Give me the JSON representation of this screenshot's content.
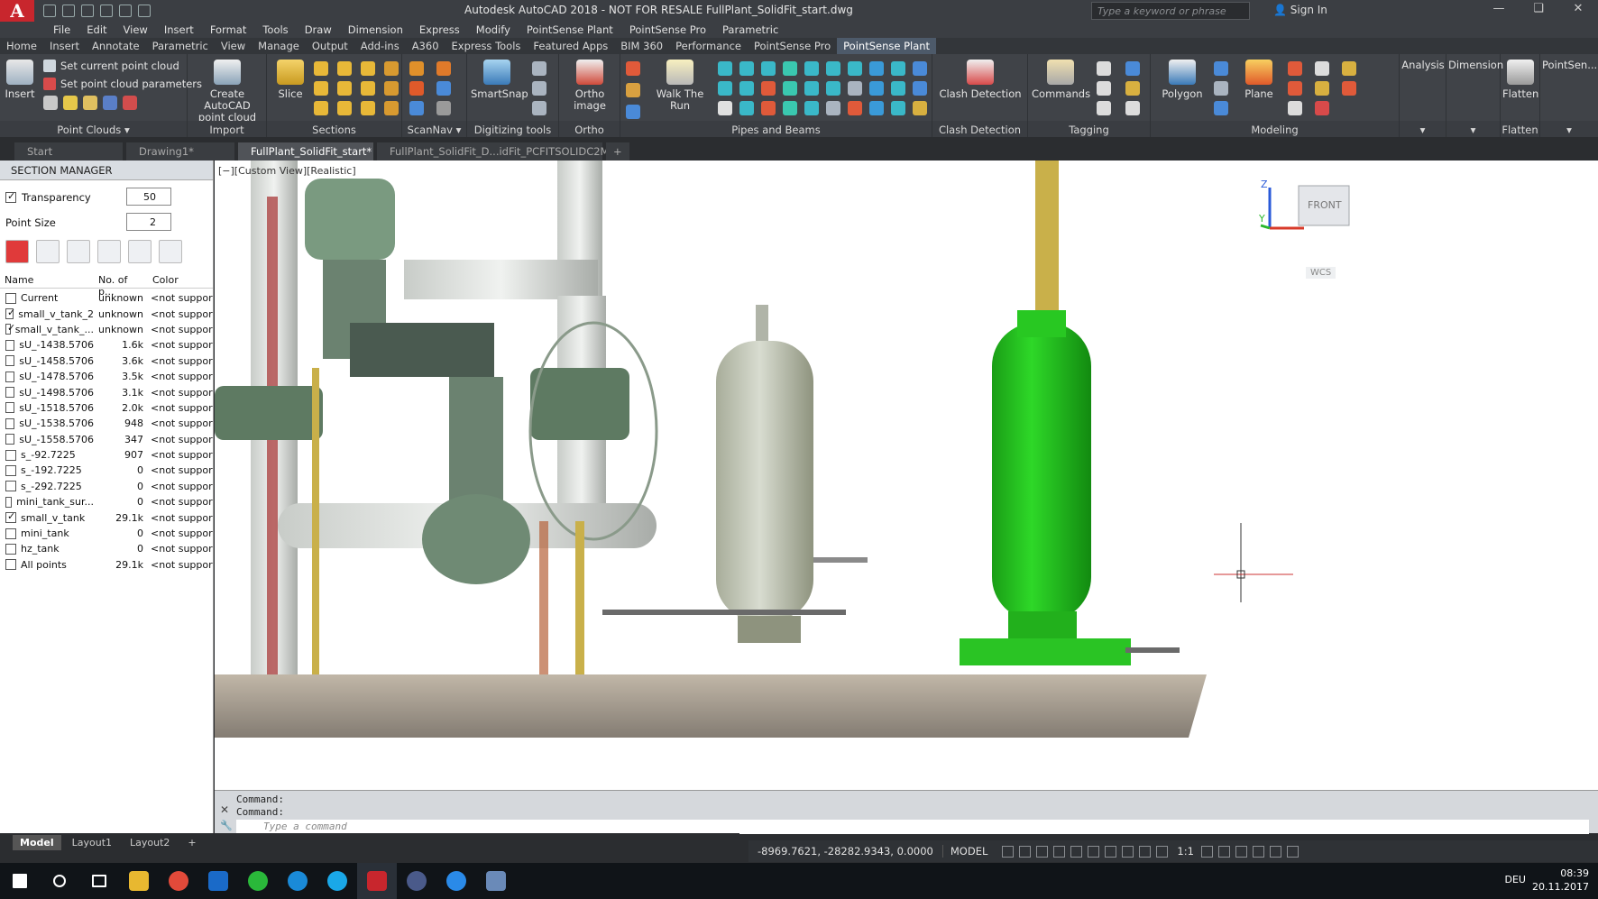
{
  "titlebar": {
    "title": "Autodesk AutoCAD 2018 - NOT FOR RESALE    FullPlant_SolidFit_start.dwg",
    "search_placeholder": "Type a keyword or phrase",
    "sign_in": "Sign In",
    "logo": "A"
  },
  "menu": [
    "File",
    "Edit",
    "View",
    "Insert",
    "Format",
    "Tools",
    "Draw",
    "Dimension",
    "Express",
    "Modify",
    "PointSense Plant",
    "PointSense Pro",
    "Parametric"
  ],
  "ribbon_tabs": [
    "Home",
    "Insert",
    "Annotate",
    "Parametric",
    "View",
    "Manage",
    "Output",
    "Add-ins",
    "A360",
    "Express Tools",
    "Featured Apps",
    "BIM 360",
    "Performance",
    "PointSense Pro",
    "PointSense Plant"
  ],
  "ribbon_active_tab": "PointSense Plant",
  "ribbon": {
    "insert": "Insert",
    "set_current_point_cloud": "Set current point cloud",
    "set_point_cloud_parameters": "Set point cloud parameters",
    "create_autocad_point_cloud_1": "Create AutoCAD",
    "create_autocad_point_cloud_2": "point cloud",
    "slice": "Slice",
    "smartsnap": "SmartSnap",
    "ortho_image": "Ortho image",
    "walk_the_run": "Walk The Run",
    "clash_detection": "Clash Detection",
    "commands": "Commands",
    "polygon": "Polygon",
    "plane": "Plane",
    "analysis": "Analysis",
    "dimension": "Dimension",
    "flatten": "Flatten",
    "pointsense": "PointSen...",
    "panels": {
      "point_clouds": "Point Clouds",
      "import": "Import",
      "sections": "Sections",
      "scannav": "ScanNav",
      "digitizing_tools": "Digitizing tools",
      "ortho_image": "Ortho image",
      "pipes_and_beams": "Pipes and Beams",
      "clash_detection": "Clash Detection",
      "tagging": "Tagging",
      "modeling": "Modeling",
      "flatten": "Flatten"
    }
  },
  "doc_tabs": [
    "Start",
    "Drawing1*",
    "FullPlant_SolidFit_start*",
    "FullPlant_SolidFit_D...idFit_PCFITSOLIDC2M*"
  ],
  "doc_active": "FullPlant_SolidFit_start*",
  "section_manager": {
    "title": "SECTION MANAGER",
    "transparency_label": "Transparency",
    "transparency_value": "50",
    "point_size_label": "Point Size",
    "point_size_value": "2",
    "columns": [
      "Name",
      "No. of p...",
      "Color"
    ],
    "rows": [
      {
        "name": "Current",
        "count": "unknown",
        "color": "<not support...",
        "checked": false
      },
      {
        "name": "small_v_tank_2",
        "count": "unknown",
        "color": "<not support...",
        "checked": true
      },
      {
        "name": "small_v_tank_...",
        "count": "unknown",
        "color": "<not support...",
        "checked": true
      },
      {
        "name": "sU_-1438.5706",
        "count": "1.6k",
        "color": "<not support...",
        "checked": false
      },
      {
        "name": "sU_-1458.5706",
        "count": "3.6k",
        "color": "<not support...",
        "checked": false
      },
      {
        "name": "sU_-1478.5706",
        "count": "3.5k",
        "color": "<not support...",
        "checked": false
      },
      {
        "name": "sU_-1498.5706",
        "count": "3.1k",
        "color": "<not support...",
        "checked": false
      },
      {
        "name": "sU_-1518.5706",
        "count": "2.0k",
        "color": "<not support...",
        "checked": false
      },
      {
        "name": "sU_-1538.5706",
        "count": "948",
        "color": "<not support...",
        "checked": false
      },
      {
        "name": "sU_-1558.5706",
        "count": "347",
        "color": "<not support...",
        "checked": false
      },
      {
        "name": "s_-92.7225",
        "count": "907",
        "color": "<not support...",
        "checked": false
      },
      {
        "name": "s_-192.7225",
        "count": "0",
        "color": "<not support...",
        "checked": false
      },
      {
        "name": "s_-292.7225",
        "count": "0",
        "color": "<not support...",
        "checked": false
      },
      {
        "name": "mini_tank_sur...",
        "count": "0",
        "color": "<not support...",
        "checked": false
      },
      {
        "name": "small_v_tank",
        "count": "29.1k",
        "color": "<not support...",
        "checked": true
      },
      {
        "name": "mini_tank",
        "count": "0",
        "color": "<not support...",
        "checked": false
      },
      {
        "name": "hz_tank",
        "count": "0",
        "color": "<not support...",
        "checked": false
      },
      {
        "name": "All points",
        "count": "29.1k",
        "color": "<not support...",
        "checked": false
      }
    ]
  },
  "viewport": {
    "label": "[−][Custom View][Realistic]",
    "viewcube_face": "FRONT",
    "wcs": "WCS",
    "axis_z": "Z",
    "axis_y": "Y"
  },
  "command": {
    "line1": "Command:",
    "line2": "Command:",
    "placeholder": "Type a command"
  },
  "layout_tabs": [
    "Model",
    "Layout1",
    "Layout2"
  ],
  "status": {
    "coords": "-8969.7621, -28282.9343, 0.0000",
    "model": "MODEL",
    "scale": "1:1"
  },
  "taskbar": {
    "language": "DEU",
    "time": "08:39",
    "date": "20.11.2017"
  },
  "colors": {
    "accent": "#c8262d",
    "solid_tank": "#22c41c",
    "ribbon": "#404348"
  }
}
